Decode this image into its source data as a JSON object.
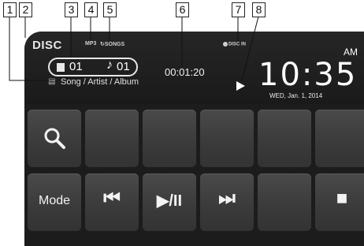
{
  "callouts": [
    "1",
    "2",
    "3",
    "4",
    "5",
    "6",
    "7",
    "8"
  ],
  "display": {
    "source": "DISC",
    "format_badge": "MP3",
    "songs_badge": "SONGS",
    "disc_in": "DISC IN",
    "folder_number": "01",
    "track_number": "01",
    "song_info": "Song / Artist / Album",
    "playtime": "00:01:20",
    "clock": "10:35",
    "ampm": "AM",
    "date": "WED, Jan. 1, 2014"
  },
  "buttons": {
    "mode_label": "Mode",
    "prev_symbol": "⏮",
    "playpause_symbol": "▶/II",
    "next_symbol": "⏭",
    "stop_symbol": "■"
  },
  "icons": [
    "search-icon",
    "folder-icon",
    "note-icon",
    "song-info-icon",
    "play-indicator-icon",
    "disc-in-icon",
    "repeat-icon"
  ]
}
